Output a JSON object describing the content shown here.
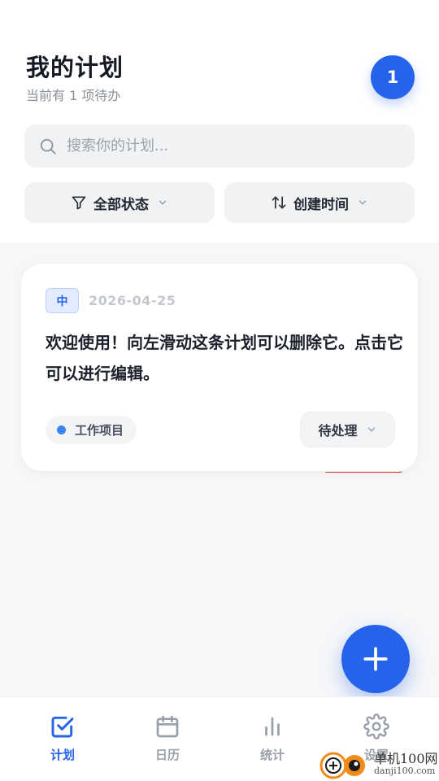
{
  "header": {
    "title": "我的计划",
    "subtitle": "当前有 1 项待办",
    "badge_count": "1"
  },
  "search": {
    "placeholder": "搜索你的计划..."
  },
  "filters": {
    "status_label": "全部状态",
    "sort_label": "创建时间"
  },
  "plans": [
    {
      "priority": "中",
      "date": "2026-04-25",
      "content": "欢迎使用！向左滑动这条计划可以删除它。点击它可以进行编辑。",
      "category": "工作项目",
      "category_color": "#3b82f6",
      "status": "待处理"
    }
  ],
  "tabbar": {
    "items": [
      {
        "label": "计划",
        "icon": "checkbox-icon",
        "active": true
      },
      {
        "label": "日历",
        "icon": "calendar-icon",
        "active": false
      },
      {
        "label": "统计",
        "icon": "bar-chart-icon",
        "active": false
      },
      {
        "label": "设置",
        "icon": "gear-icon",
        "active": false
      }
    ]
  },
  "colors": {
    "accent": "#2563eb",
    "priority_bg": "#e3ecfe",
    "delete_hint": "#e53935"
  },
  "watermark": {
    "line1": "单机100网",
    "line2": "danji100.com"
  }
}
